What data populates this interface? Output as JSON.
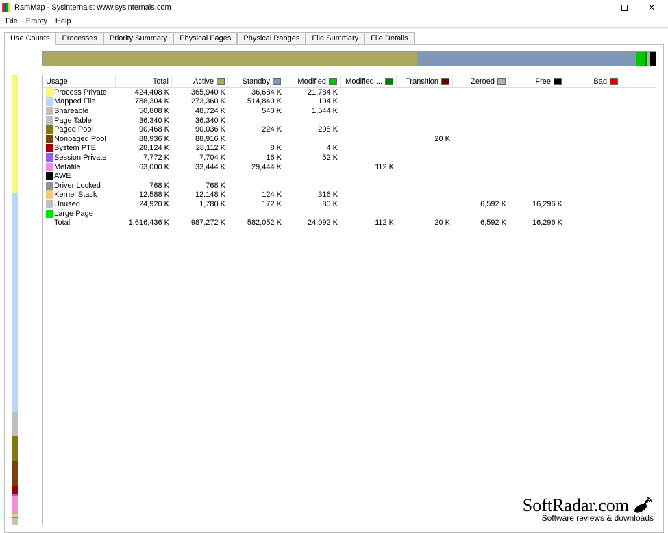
{
  "window": {
    "title": "RamMap - Sysinternals: www.sysinternals.com",
    "icon_colors": [
      "#e03030",
      "#2050c0",
      "#00a000",
      "#e8d030"
    ]
  },
  "menus": [
    "File",
    "Empty",
    "Help"
  ],
  "tabs": [
    "Use Counts",
    "Processes",
    "Priority Summary",
    "Physical Pages",
    "Physical Ranges",
    "File Summary",
    "File Details"
  ],
  "active_tab": 0,
  "columns": [
    {
      "label": "Usage"
    },
    {
      "label": "Total"
    },
    {
      "label": "Active",
      "color": "#aca860"
    },
    {
      "label": "Standby",
      "color": "#7e98b8"
    },
    {
      "label": "Modified",
      "color": "#00c800"
    },
    {
      "label": "Modified ...",
      "color": "#008000"
    },
    {
      "label": "Transition",
      "color": "#600808"
    },
    {
      "label": "Zeroed",
      "color": "#b0b0b0"
    },
    {
      "label": "Free",
      "color": "#000000"
    },
    {
      "label": "Bad",
      "color": "#e00000"
    }
  ],
  "rows": [
    {
      "color": "#f8f880",
      "name": "Process Private",
      "v": [
        "424,408 K",
        "365,940 K",
        "36,684 K",
        "21,784 K",
        "",
        "",
        "",
        "",
        ""
      ]
    },
    {
      "color": "#b8d8f8",
      "name": "Mapped File",
      "v": [
        "788,304 K",
        "273,360 K",
        "514,840 K",
        "104 K",
        "",
        "",
        "",
        "",
        ""
      ]
    },
    {
      "color": "#c0c0c0",
      "name": "Shareable",
      "v": [
        "50,808 K",
        "48,724 K",
        "540 K",
        "1,544 K",
        "",
        "",
        "",
        "",
        ""
      ]
    },
    {
      "color": "#c0c0c0",
      "name": "Page Table",
      "v": [
        "36,340 K",
        "36,340 K",
        "",
        "",
        "",
        "",
        "",
        "",
        ""
      ]
    },
    {
      "color": "#807810",
      "name": "Paged Pool",
      "v": [
        "90,468 K",
        "90,036 K",
        "224 K",
        "208 K",
        "",
        "",
        "",
        "",
        ""
      ]
    },
    {
      "color": "#784010",
      "name": "Nonpaged Pool",
      "v": [
        "88,936 K",
        "88,916 K",
        "",
        "",
        "",
        "20 K",
        "",
        "",
        ""
      ]
    },
    {
      "color": "#a00000",
      "name": "System PTE",
      "v": [
        "28,124 K",
        "28,112 K",
        "8 K",
        "4 K",
        "",
        "",
        "",
        "",
        ""
      ]
    },
    {
      "color": "#9060f0",
      "name": "Session Private",
      "v": [
        "7,772 K",
        "7,704 K",
        "16 K",
        "52 K",
        "",
        "",
        "",
        "",
        ""
      ]
    },
    {
      "color": "#f090d0",
      "name": "Metafile",
      "v": [
        "63,000 K",
        "33,444 K",
        "29,444 K",
        "",
        "112 K",
        "",
        "",
        "",
        ""
      ]
    },
    {
      "color": "#000000",
      "name": "AWE",
      "v": [
        "",
        "",
        "",
        "",
        "",
        "",
        "",
        "",
        ""
      ]
    },
    {
      "color": "#909090",
      "name": "Driver Locked",
      "v": [
        "768 K",
        "768 K",
        "",
        "",
        "",
        "",
        "",
        "",
        ""
      ]
    },
    {
      "color": "#f0c880",
      "name": "Kernel Stack",
      "v": [
        "12,588 K",
        "12,148 K",
        "124 K",
        "316 K",
        "",
        "",
        "",
        "",
        ""
      ]
    },
    {
      "color": "#c0c0c0",
      "name": "Unused",
      "v": [
        "24,920 K",
        "1,780 K",
        "172 K",
        "80 K",
        "",
        "",
        "6,592 K",
        "16,296 K",
        ""
      ]
    },
    {
      "color": "#00e000",
      "name": "Large Page",
      "v": [
        "",
        "",
        "",
        "",
        "",
        "",
        "",
        "",
        ""
      ]
    }
  ],
  "total_row": {
    "name": "Total",
    "v": [
      "1,616,436 K",
      "987,272 K",
      "582,052 K",
      "24,092 K",
      "112 K",
      "20 K",
      "6,592 K",
      "16,296 K",
      ""
    ]
  },
  "hbar": [
    {
      "color": "#aca860",
      "flex": 987
    },
    {
      "color": "#7e98b8",
      "flex": 582
    },
    {
      "color": "#00c800",
      "flex": 24
    },
    {
      "color": "#008000",
      "flex": 4
    },
    {
      "color": "#b0b0b0",
      "flex": 7
    },
    {
      "color": "#000000",
      "flex": 16
    }
  ],
  "vbar": [
    {
      "color": "#f8f880",
      "flex": 424
    },
    {
      "color": "#b8d8f8",
      "flex": 788
    },
    {
      "color": "#c0c0c0",
      "flex": 87
    },
    {
      "color": "#807810",
      "flex": 90
    },
    {
      "color": "#784010",
      "flex": 89
    },
    {
      "color": "#a00000",
      "flex": 28
    },
    {
      "color": "#9060f0",
      "flex": 8
    },
    {
      "color": "#f090d0",
      "flex": 63
    },
    {
      "color": "#909090",
      "flex": 1
    },
    {
      "color": "#f0c880",
      "flex": 13
    },
    {
      "color": "#00e000",
      "flex": 1
    },
    {
      "color": "#c0c0c0",
      "flex": 28
    }
  ],
  "watermark": {
    "big": "SoftRadar.com",
    "small": "Software reviews & downloads"
  }
}
